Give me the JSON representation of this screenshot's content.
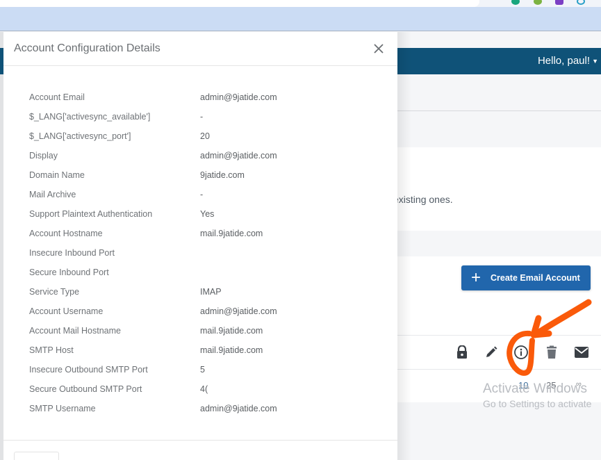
{
  "browser": {
    "extension_colors": [
      "#1aa67d",
      "#7cb342",
      "#7b3fc4",
      "#2aa0c8"
    ]
  },
  "page": {
    "greeting": "Hello, paul!",
    "intro_text": "mail accounts and handle the existing ones.",
    "create_button_label": "Create Email Account",
    "action_icons": [
      {
        "name": "lock-icon",
        "label": "Change password"
      },
      {
        "name": "pencil-icon",
        "label": "Edit"
      },
      {
        "name": "info-icon",
        "label": "Account configuration details"
      },
      {
        "name": "trash-icon",
        "label": "Delete"
      },
      {
        "name": "envelope-icon",
        "label": "Webmail"
      }
    ],
    "pager": [
      "10",
      "25",
      "∞"
    ],
    "pager_active": "10"
  },
  "modal": {
    "title": "Account Configuration Details",
    "close_label": "×",
    "details": [
      {
        "label": "Account Email",
        "value": "admin@9jatide.com"
      },
      {
        "label": "$_LANG['activesync_available']",
        "value": "-"
      },
      {
        "label": "$_LANG['activesync_port']",
        "value": "20"
      },
      {
        "label": "Display",
        "value": "admin@9jatide.com"
      },
      {
        "label": "Domain Name",
        "value": "9jatide.com"
      },
      {
        "label": "Mail Archive",
        "value": "-"
      },
      {
        "label": "Support Plaintext Authentication",
        "value": "Yes"
      },
      {
        "label": "Account Hostname",
        "value": "mail.9jatide.com"
      },
      {
        "label": "Insecure Inbound Port",
        "value": ""
      },
      {
        "label": "Secure Inbound Port",
        "value": ""
      },
      {
        "label": "Service Type",
        "value": "IMAP"
      },
      {
        "label": "Account Username",
        "value": "admin@9jatide.com"
      },
      {
        "label": "Account Mail Hostname",
        "value": "mail.9jatide.com"
      },
      {
        "label": "SMTP Host",
        "value": "mail.9jatide.com"
      },
      {
        "label": "Insecure Outbound SMTP Port",
        "value": "5"
      },
      {
        "label": "Secure Outbound SMTP Port",
        "value": "4("
      },
      {
        "label": "SMTP Username",
        "value": "admin@9jatide.com"
      }
    ]
  },
  "watermark": {
    "line1": "Activate Windows",
    "line2": "Go to Settings to activate"
  },
  "colors": {
    "navbar": "#0f5278",
    "primary_button": "#2166ac",
    "annotation": "#fa5a0a"
  }
}
